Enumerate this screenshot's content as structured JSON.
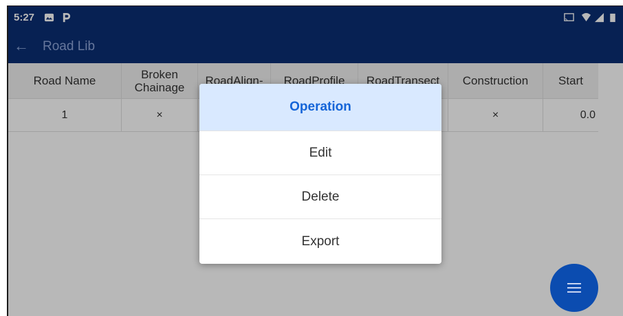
{
  "statusbar": {
    "time": "5:27",
    "icons": [
      "gallery-icon",
      "parking-icon",
      "cast-icon",
      "wifi-icon",
      "signal-icon",
      "battery-icon"
    ]
  },
  "appbar": {
    "title": "Road Lib",
    "back_icon": "back-arrow-icon"
  },
  "table": {
    "headers": [
      "Road Name",
      "Broken\nChainage",
      "RoadAlign-",
      "RoadProfile",
      "RoadTransect",
      "Construction",
      "Start"
    ],
    "rows": [
      [
        "1",
        "×",
        "",
        "",
        "×",
        "×",
        "0.0"
      ]
    ]
  },
  "dialog": {
    "title": "Operation",
    "items": [
      "Edit",
      "Delete",
      "Export"
    ]
  },
  "fab": {
    "icon": "menu-icon"
  },
  "colors": {
    "primary": "#0b2e73",
    "accent": "#1565d8",
    "fab": "#0b4cb0"
  }
}
